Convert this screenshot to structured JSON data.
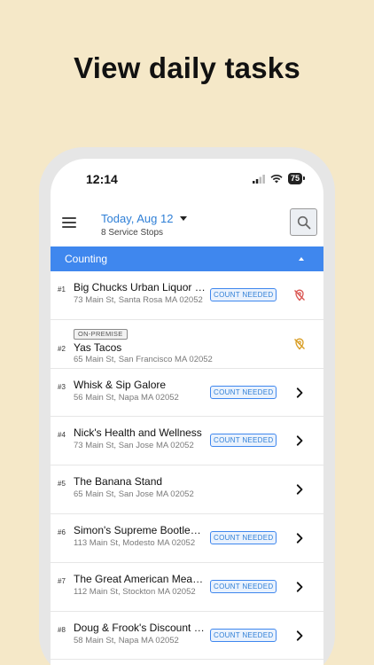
{
  "headline": "View daily tasks",
  "status_bar": {
    "time": "12:14",
    "battery": "75"
  },
  "header": {
    "date": "Today, Aug 12",
    "subtitle": "8 Service Stops"
  },
  "section": {
    "label": "Counting"
  },
  "colors": {
    "accent": "#3f87ee",
    "alert_red": "#d9534f",
    "alert_amber": "#d89b1f",
    "background": "#f5e8c8"
  },
  "stops": [
    {
      "num": "#1",
      "name": "Big Chucks Urban Liquor Store",
      "address": "73 Main St, Santa Rosa MA 02052",
      "badge": "COUNT NEEDED",
      "icon": "location-off-red"
    },
    {
      "num": "#2",
      "name": "Yas Tacos",
      "address": "65 Main St, San Francisco MA 02052",
      "tag": "ON-PREMISE",
      "icon": "location-off-amber"
    },
    {
      "num": "#3",
      "name": "Whisk & Sip Galore",
      "address": "56 Main St, Napa MA 02052",
      "badge": "COUNT NEEDED",
      "icon": "chevron"
    },
    {
      "num": "#4",
      "name": "Nick's Health and Wellness",
      "address": "73 Main St, San Jose MA 02052",
      "badge": "COUNT NEEDED",
      "icon": "chevron"
    },
    {
      "num": "#5",
      "name": "The Banana Stand",
      "address": "65 Main St, San Jose MA 02052",
      "icon": "chevron"
    },
    {
      "num": "#6",
      "name": "Simon's Supreme Bootlegger",
      "address": "113 Main St, Modesto MA 02052",
      "badge": "COUNT NEEDED",
      "icon": "chevron"
    },
    {
      "num": "#7",
      "name": "The Great American Meadery",
      "address": "112 Main St, Stockton MA 02052",
      "badge": "COUNT NEEDED",
      "icon": "chevron"
    },
    {
      "num": "#8",
      "name": "Doug & Frook's Discount Liquor",
      "address": "58 Main St, Napa MA 02052",
      "badge": "COUNT NEEDED",
      "icon": "chevron"
    }
  ]
}
